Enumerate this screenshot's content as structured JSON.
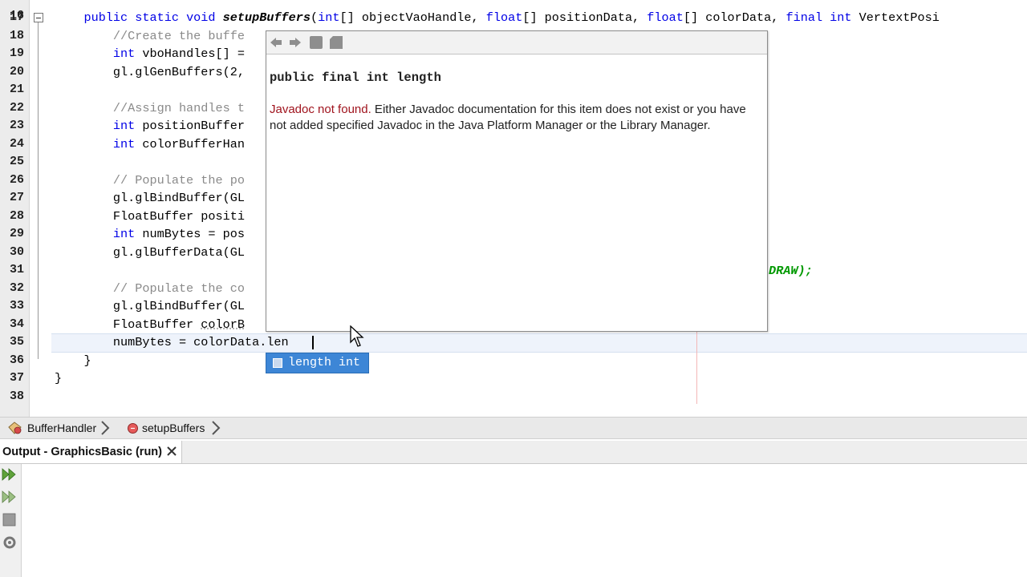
{
  "editor": {
    "lines": [
      {
        "num": "17",
        "segments": [
          {
            "t": "    ",
            "c": ""
          },
          {
            "t": "public static void ",
            "c": "kw"
          },
          {
            "t": "setupBuffers",
            "c": "fn"
          },
          {
            "t": "(",
            "c": ""
          },
          {
            "t": "int",
            "c": "kw"
          },
          {
            "t": "[] objectVaoHandle, ",
            "c": ""
          },
          {
            "t": "float",
            "c": "kw"
          },
          {
            "t": "[] positionData, ",
            "c": ""
          },
          {
            "t": "float",
            "c": "kw"
          },
          {
            "t": "[] colorData, ",
            "c": ""
          },
          {
            "t": "final int ",
            "c": "kw"
          },
          {
            "t": "VertextPosi",
            "c": ""
          }
        ]
      },
      {
        "num": "18",
        "segments": [
          {
            "t": "        ",
            "c": ""
          },
          {
            "t": "//Create the buffe",
            "c": "cm"
          }
        ]
      },
      {
        "num": "19",
        "segments": [
          {
            "t": "        ",
            "c": ""
          },
          {
            "t": "int ",
            "c": "kw"
          },
          {
            "t": "vboHandles[] =",
            "c": ""
          }
        ]
      },
      {
        "num": "20",
        "segments": [
          {
            "t": "        gl.glGenBuffers(2,",
            "c": ""
          }
        ]
      },
      {
        "num": "21",
        "segments": []
      },
      {
        "num": "22",
        "segments": [
          {
            "t": "        ",
            "c": ""
          },
          {
            "t": "//Assign handles t",
            "c": "cm"
          }
        ]
      },
      {
        "num": "23",
        "segments": [
          {
            "t": "        ",
            "c": ""
          },
          {
            "t": "int ",
            "c": "kw"
          },
          {
            "t": "positionBuffer",
            "c": ""
          }
        ]
      },
      {
        "num": "24",
        "segments": [
          {
            "t": "        ",
            "c": ""
          },
          {
            "t": "int ",
            "c": "kw"
          },
          {
            "t": "colorBufferHan",
            "c": ""
          }
        ]
      },
      {
        "num": "25",
        "segments": []
      },
      {
        "num": "26",
        "segments": [
          {
            "t": "        ",
            "c": ""
          },
          {
            "t": "// Populate the po",
            "c": "cm"
          }
        ]
      },
      {
        "num": "27",
        "segments": [
          {
            "t": "        gl.glBindBuffer(GL",
            "c": ""
          }
        ]
      },
      {
        "num": "28",
        "segments": [
          {
            "t": "        FloatBuffer positi",
            "c": ""
          }
        ]
      },
      {
        "num": "29",
        "segments": [
          {
            "t": "        ",
            "c": ""
          },
          {
            "t": "int ",
            "c": "kw"
          },
          {
            "t": "numBytes = pos",
            "c": ""
          }
        ]
      },
      {
        "num": "30",
        "segments": [
          {
            "t": "        gl.glBufferData(GL",
            "c": ""
          }
        ]
      },
      {
        "num": "31",
        "segments": []
      },
      {
        "num": "32",
        "segments": [
          {
            "t": "        ",
            "c": ""
          },
          {
            "t": "// Populate the co",
            "c": "cm"
          }
        ]
      },
      {
        "num": "33",
        "segments": [
          {
            "t": "        gl.glBindBuffer(GL",
            "c": ""
          }
        ]
      },
      {
        "num": "34",
        "segments": [
          {
            "t": "        FloatBuffer ",
            "c": ""
          },
          {
            "t": "colorB",
            "c": "ul"
          }
        ]
      },
      {
        "num": "35",
        "segments": [
          {
            "t": "        numBytes = colorData.len",
            "c": ""
          }
        ]
      },
      {
        "num": "36",
        "segments": [
          {
            "t": "    }",
            "c": ""
          }
        ]
      },
      {
        "num": "37",
        "segments": [
          {
            "t": "}",
            "c": ""
          }
        ]
      },
      {
        "num": "38",
        "segments": []
      }
    ],
    "line30_tail": "DRAW);",
    "top_partial_line_num": "16"
  },
  "javadoc": {
    "signature": "public final int length",
    "msg_red": "Javadoc not found.",
    "msg_rest": " Either Javadoc documentation for this item does not exist or you have not added specified Javadoc in the Java Platform Manager or the Library Manager."
  },
  "completion": {
    "item_label": "length int"
  },
  "breadcrumb": {
    "class_name": "BufferHandler",
    "method_name": "setupBuffers"
  },
  "output": {
    "tab_label": "Output - GraphicsBasic (run)"
  },
  "colors": {
    "keyword": "#0000e6",
    "comment": "#8a8a8a",
    "constant": "#009900",
    "javadoc_error": "#a0141e",
    "completion_selected": "#3d86d6"
  }
}
